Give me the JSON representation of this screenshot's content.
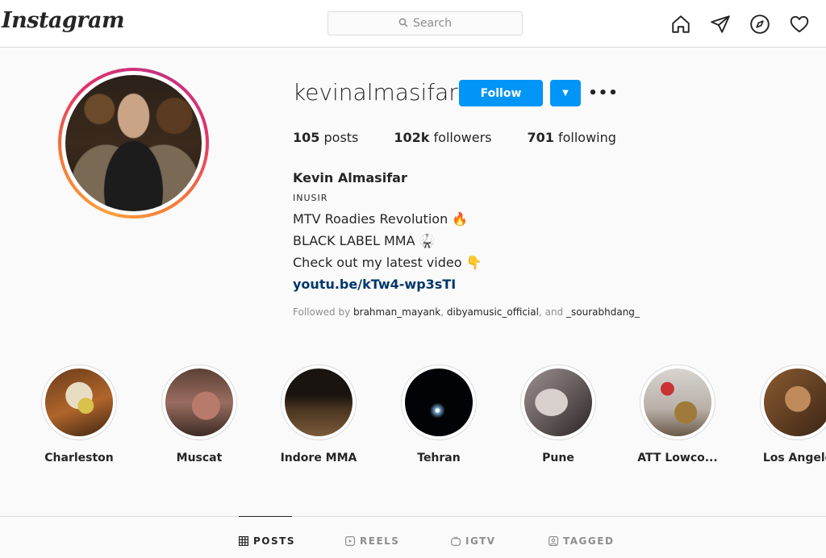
{
  "topbar": {
    "logo": "Instagram",
    "search_placeholder": "Search",
    "nav_icons": [
      "home-icon",
      "direct-message-icon",
      "explore-compass-icon",
      "activity-heart-icon"
    ]
  },
  "profile": {
    "username": "kevinalmasifar",
    "follow_label": "Follow",
    "stats": {
      "posts_num": "105",
      "posts_label": "posts",
      "followers_num": "102k",
      "followers_label": "followers",
      "following_num": "701",
      "following_label": "following"
    },
    "bio": {
      "full_name": "Kevin Almasifar",
      "category": "INUSIR",
      "line1": "MTV Roadies Revolution 🔥",
      "line2": "BLACK LABEL MMA 🥋",
      "line3": "Check out my latest video 👇",
      "link": "youtu.be/kTw4-wp3sTI"
    },
    "followed_by": {
      "prefix": "Followed by",
      "user1": "brahman_mayank",
      "sep1": ",",
      "user2": "dibyamusic_official",
      "sep2": ", and",
      "user3": "_sourabhdang_"
    }
  },
  "highlights": [
    {
      "label": "Charleston"
    },
    {
      "label": "Muscat"
    },
    {
      "label": "Indore MMA"
    },
    {
      "label": "Tehran"
    },
    {
      "label": "Pune"
    },
    {
      "label": "ATT Lowco..."
    },
    {
      "label": "Los Angele"
    }
  ],
  "tabs": [
    {
      "label": "POSTS",
      "icon": "grid-icon",
      "active": true
    },
    {
      "label": "REELS",
      "icon": "reels-icon",
      "active": false
    },
    {
      "label": "IGTV",
      "icon": "igtv-icon",
      "active": false
    },
    {
      "label": "TAGGED",
      "icon": "tagged-icon",
      "active": false
    }
  ],
  "colors": {
    "accent": "#0095f6",
    "link": "#00376b",
    "muted": "#8e8e8e",
    "border": "#dbdbdb"
  }
}
